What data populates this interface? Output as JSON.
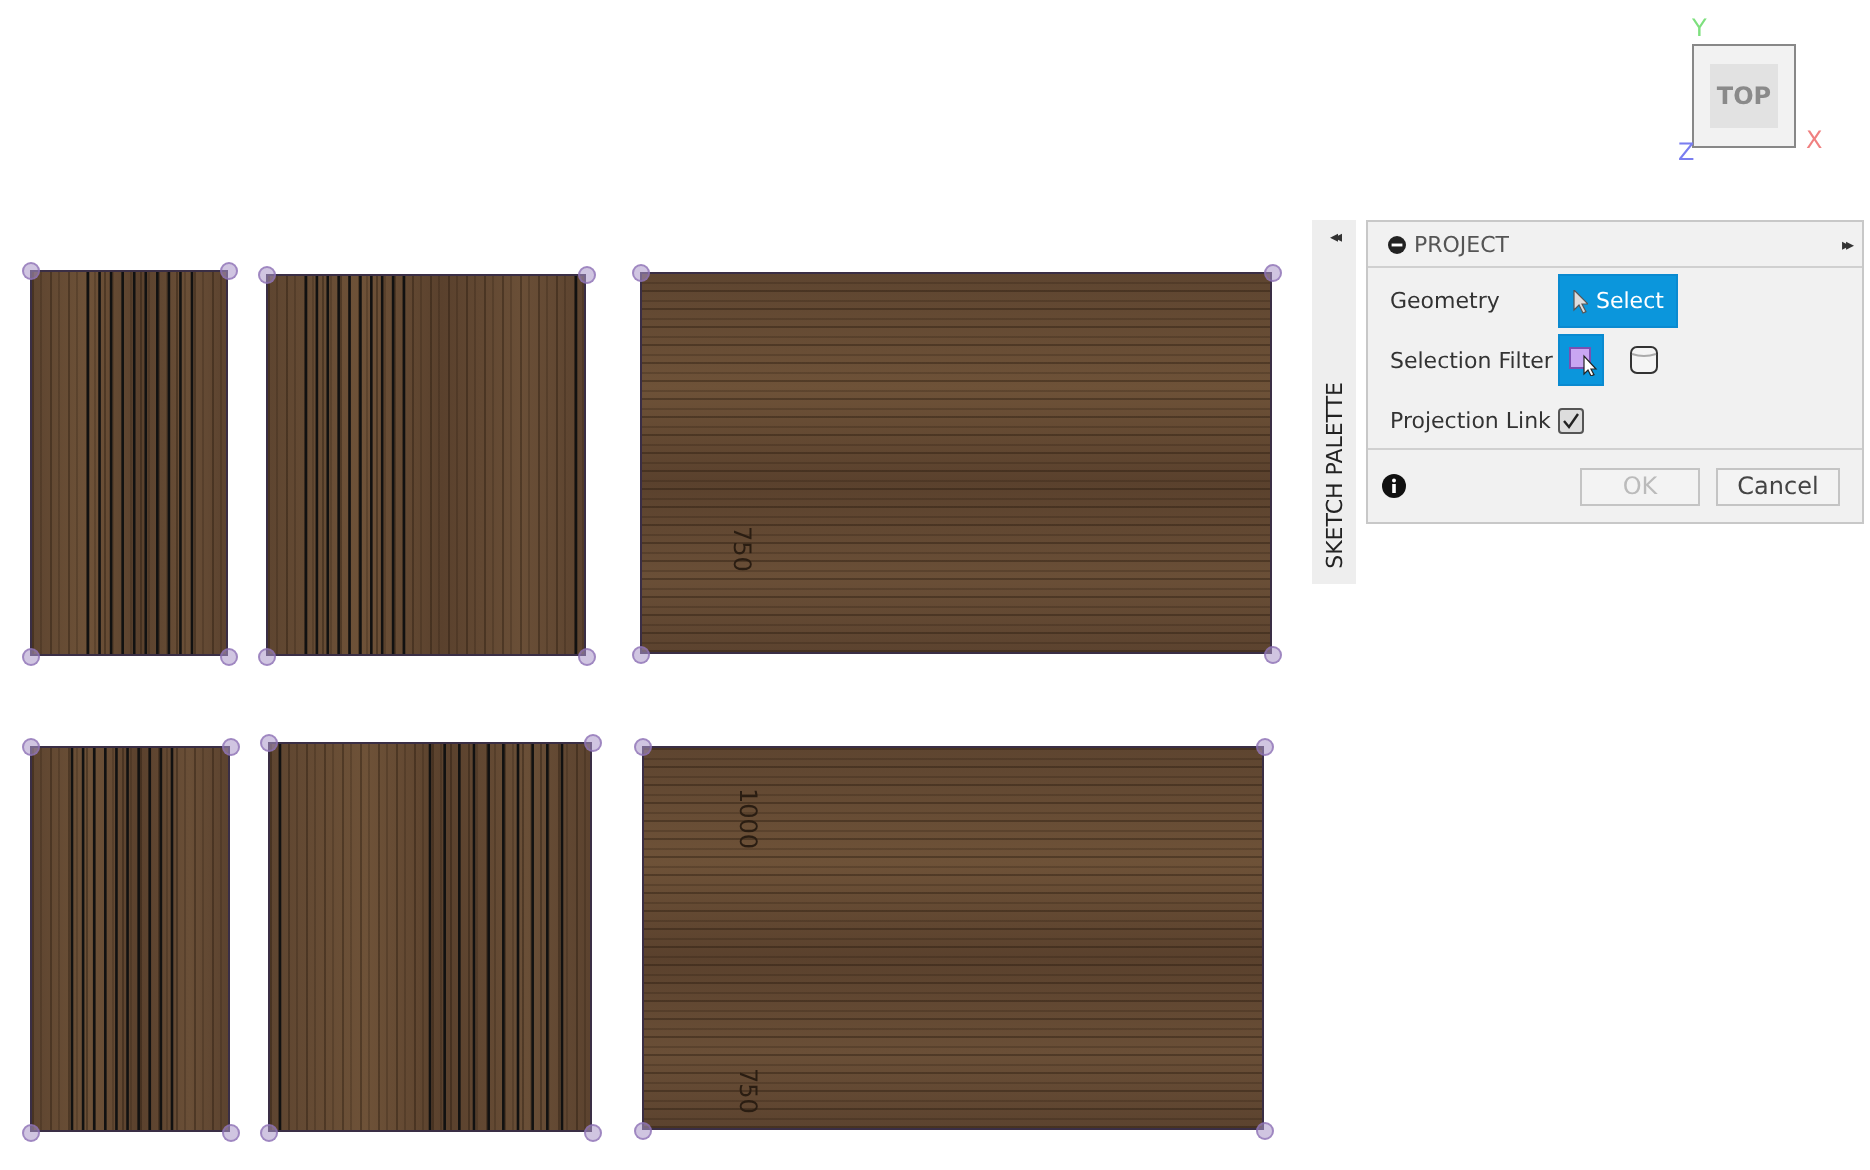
{
  "view_cube": {
    "face": "TOP",
    "axis_y": "Y",
    "axis_x": "X",
    "axis_z": "Z"
  },
  "dimension_labels": [
    {
      "text": "750"
    },
    {
      "text": "1000"
    },
    {
      "text": "750"
    }
  ],
  "sketch_palette": {
    "tab": "SKETCH PALETTE",
    "collapse": "◂◂"
  },
  "project_panel": {
    "title": "PROJECT",
    "expand": "▸▸",
    "rows": [
      {
        "kind": "button",
        "label": "Geometry",
        "button": "Select",
        "selected": true
      },
      {
        "kind": "filters",
        "label": "Selection Filter",
        "filters": [
          {
            "selected": true
          },
          {
            "selected": false
          }
        ]
      },
      {
        "kind": "checkbox",
        "label": "Projection Link",
        "checked": true
      }
    ],
    "ok": {
      "label": "OK",
      "disabled": true
    },
    "cancel": {
      "label": "Cancel"
    }
  }
}
